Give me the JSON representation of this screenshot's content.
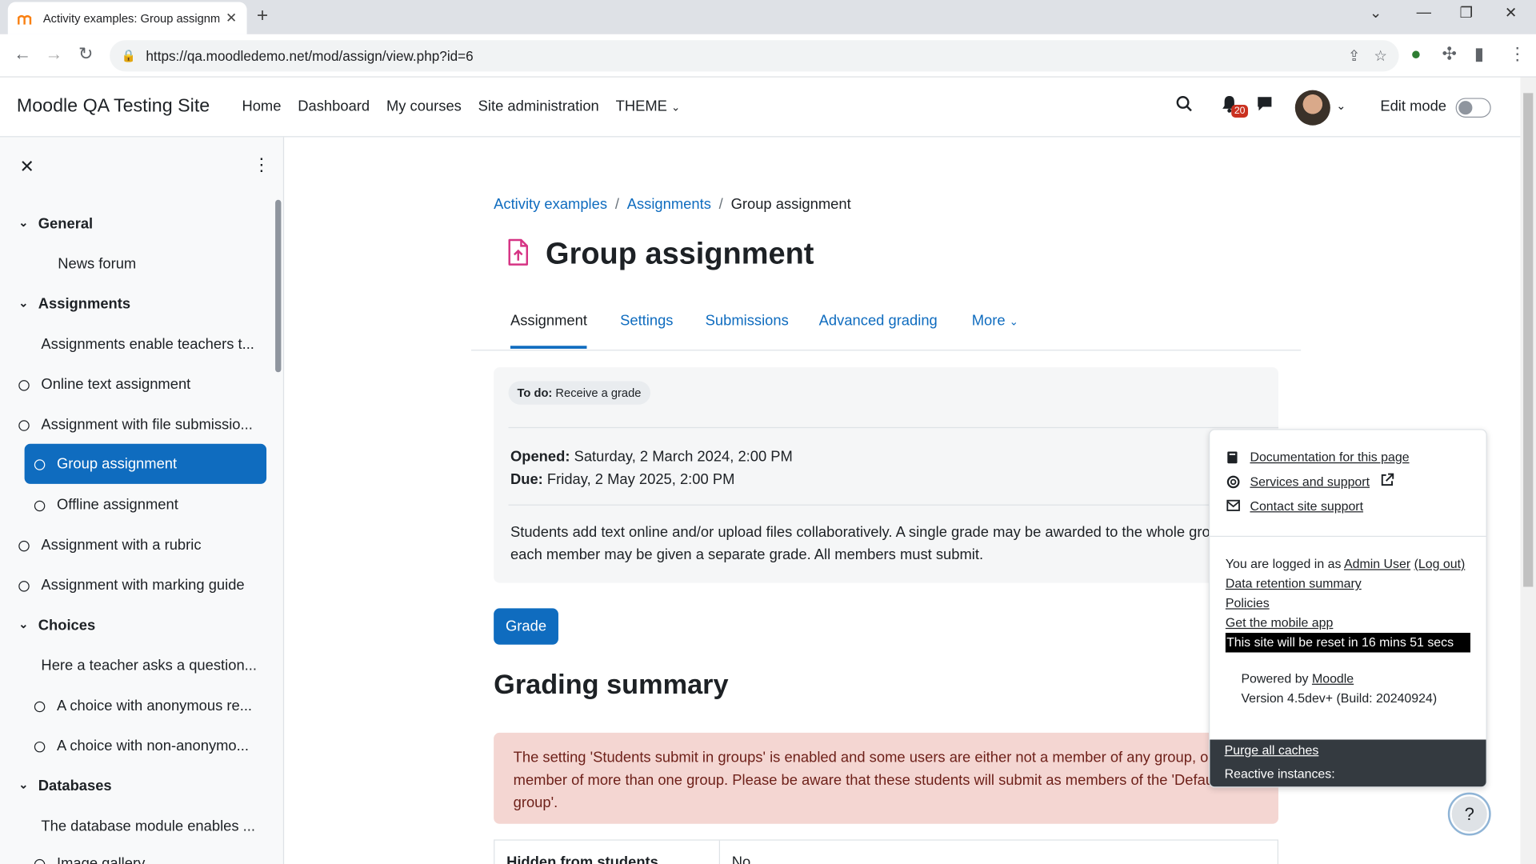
{
  "browser": {
    "tab_title": "Activity examples: Group assignm",
    "url": "https://qa.moodledemo.net/mod/assign/view.php?id=6"
  },
  "navbar": {
    "site_name": "Moodle QA Testing Site",
    "links": [
      "Home",
      "Dashboard",
      "My courses",
      "Site administration",
      "THEME"
    ],
    "notification_count": "20",
    "edit_mode_label": "Edit mode"
  },
  "drawer": {
    "items": [
      {
        "label": "General",
        "type": "section"
      },
      {
        "label": "News forum",
        "type": "item"
      },
      {
        "label": "Assignments",
        "type": "section"
      },
      {
        "label": "Assignments enable teachers t...",
        "type": "item"
      },
      {
        "label": "Online text assignment",
        "type": "activity"
      },
      {
        "label": "Assignment with file submissio...",
        "type": "activity"
      },
      {
        "label": "Group assignment",
        "type": "activity-active"
      },
      {
        "label": "Offline assignment",
        "type": "activity-indent"
      },
      {
        "label": "Assignment with a rubric",
        "type": "activity"
      },
      {
        "label": "Assignment with marking guide",
        "type": "activity"
      },
      {
        "label": "Choices",
        "type": "section"
      },
      {
        "label": "Here a teacher asks a question...",
        "type": "item"
      },
      {
        "label": "A choice with anonymous re...",
        "type": "activity-indent"
      },
      {
        "label": "A choice with non-anonymo...",
        "type": "activity-indent"
      },
      {
        "label": "Databases",
        "type": "section"
      },
      {
        "label": "The database module enables ...",
        "type": "item"
      },
      {
        "label": "Image gallery",
        "type": "activity-indent"
      }
    ]
  },
  "breadcrumb": [
    "Activity examples",
    "Assignments",
    "Group assignment"
  ],
  "page_title": "Group assignment",
  "tabs": [
    "Assignment",
    "Settings",
    "Submissions",
    "Advanced grading",
    "More"
  ],
  "activity": {
    "todo_label": "To do:",
    "todo_value": "Receive a grade",
    "opened_label": "Opened:",
    "opened_value": "Saturday, 2 March 2024, 2:00 PM",
    "due_label": "Due:",
    "due_value": "Friday, 2 May 2025, 2:00 PM",
    "description": "Students add  text online and/or upload files collaboratively. A single  grade may be awarded to the whole group or each member may be given a separate grade. All members must submit."
  },
  "grade_button": "Grade",
  "grading_summary_title": "Grading summary",
  "alert_text": "The setting 'Students submit in groups' is enabled and some users are either not a member of any group, or are a member of more than one group. Please be aware that these students will submit as members of the 'Default group'.",
  "summary_table": {
    "row_label": "Hidden from students",
    "row_value": "No"
  },
  "footer_popover": {
    "links": [
      "Documentation for this page",
      "Services and support",
      "Contact site support"
    ],
    "logged_in_prefix": "You are logged in as",
    "user": "Admin User",
    "logout": "(Log out)",
    "data_retention": "Data retention summary",
    "policies": "Policies",
    "mobile_app": "Get the mobile app",
    "reset_notice": "This site will be reset in 16 mins 51 secs",
    "powered_by": "Powered by",
    "moodle": "Moodle",
    "version": "Version 4.5dev+ (Build: 20240924)",
    "purge": "Purge all caches",
    "reactive": "Reactive instances:"
  },
  "help_button": "?",
  "colors": {
    "primary": "#0f6cbf",
    "alert_bg": "#f4d6d2",
    "badge": "#ca3120"
  }
}
